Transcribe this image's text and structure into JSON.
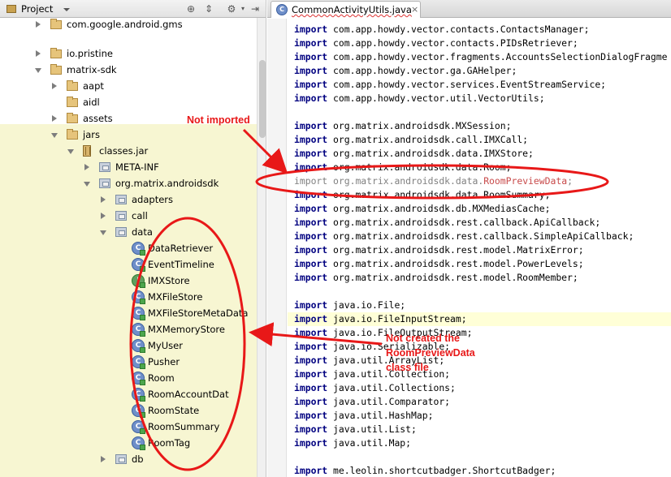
{
  "project_panel": {
    "tab_label": "Project",
    "tree": [
      {
        "label": "com.google.android.gms",
        "icon": "folder-icon"
      },
      {
        "label": "io.pristine",
        "icon": "folder-icon"
      },
      {
        "label": "matrix-sdk",
        "icon": "folder-icon"
      },
      {
        "label": "aapt",
        "icon": "folder-icon"
      },
      {
        "label": "aidl",
        "icon": "folder-icon"
      },
      {
        "label": "assets",
        "icon": "folder-icon"
      },
      {
        "label": "jars",
        "icon": "folder-icon"
      },
      {
        "label": "classes.jar",
        "icon": "jar-icon"
      },
      {
        "label": "META-INF",
        "icon": "package-icon"
      },
      {
        "label": "org.matrix.androidsdk",
        "icon": "package-icon"
      },
      {
        "label": "adapters",
        "icon": "package-icon"
      },
      {
        "label": "call",
        "icon": "package-icon"
      },
      {
        "label": "data",
        "icon": "package-icon"
      },
      {
        "label": "DataRetriever",
        "icon": "class-icon"
      },
      {
        "label": "EventTimeline",
        "icon": "class-icon"
      },
      {
        "label": "IMXStore",
        "icon": "interface-icon"
      },
      {
        "label": "MXFileStore",
        "icon": "class-icon"
      },
      {
        "label": "MXFileStoreMetaData",
        "icon": "class-icon"
      },
      {
        "label": "MXMemoryStore",
        "icon": "class-icon"
      },
      {
        "label": "MyUser",
        "icon": "class-icon"
      },
      {
        "label": "Pusher",
        "icon": "class-icon"
      },
      {
        "label": "Room",
        "icon": "class-icon"
      },
      {
        "label": "RoomAccountDat",
        "icon": "class-icon"
      },
      {
        "label": "RoomState",
        "icon": "class-icon"
      },
      {
        "label": "RoomSummary",
        "icon": "class-icon"
      },
      {
        "label": "RoomTag",
        "icon": "class-icon"
      },
      {
        "label": "db",
        "icon": "package-icon"
      }
    ]
  },
  "editor": {
    "tab_label": "CommonActivityUtils.java",
    "tab_close": "×",
    "keyword": "import",
    "lines": [
      "com.app.howdy.vector.contacts.ContactsManager;",
      "com.app.howdy.vector.contacts.PIDsRetriever;",
      "com.app.howdy.vector.fragments.AccountsSelectionDialogFragme",
      "com.app.howdy.vector.ga.GAHelper;",
      "com.app.howdy.vector.services.EventStreamService;",
      "com.app.howdy.vector.util.VectorUtils;",
      "",
      "org.matrix.androidsdk.MXSession;",
      "org.matrix.androidsdk.call.IMXCall;",
      "org.matrix.androidsdk.data.IMXStore;",
      "org.matrix.androidsdk.data.Room;",
      "org.matrix.androidsdk.data.RoomPreviewData;",
      "org.matrix.androidsdk.data.RoomSummary;",
      "org.matrix.androidsdk.db.MXMediasCache;",
      "org.matrix.androidsdk.rest.callback.ApiCallback;",
      "org.matrix.androidsdk.rest.callback.SimpleApiCallback;",
      "org.matrix.androidsdk.rest.model.MatrixError;",
      "org.matrix.androidsdk.rest.model.PowerLevels;",
      "org.matrix.androidsdk.rest.model.RoomMember;",
      "",
      "java.io.File;",
      "java.io.FileInputStream;",
      "java.io.FileOutputStream;",
      "java.io.Serializable;",
      "java.util.ArrayList;",
      "java.util.Collection;",
      "java.util.Collections;",
      "java.util.Comparator;",
      "java.util.HashMap;",
      "java.util.List;",
      "java.util.Map;",
      "",
      "me.leolin.shortcutbadger.ShortcutBadger;"
    ]
  },
  "annotations": {
    "not_imported": "Not imported",
    "not_created_1": "Not created the",
    "not_created_2": "RoomPreviewData",
    "not_created_3": "class file",
    "color": "#e81818"
  }
}
